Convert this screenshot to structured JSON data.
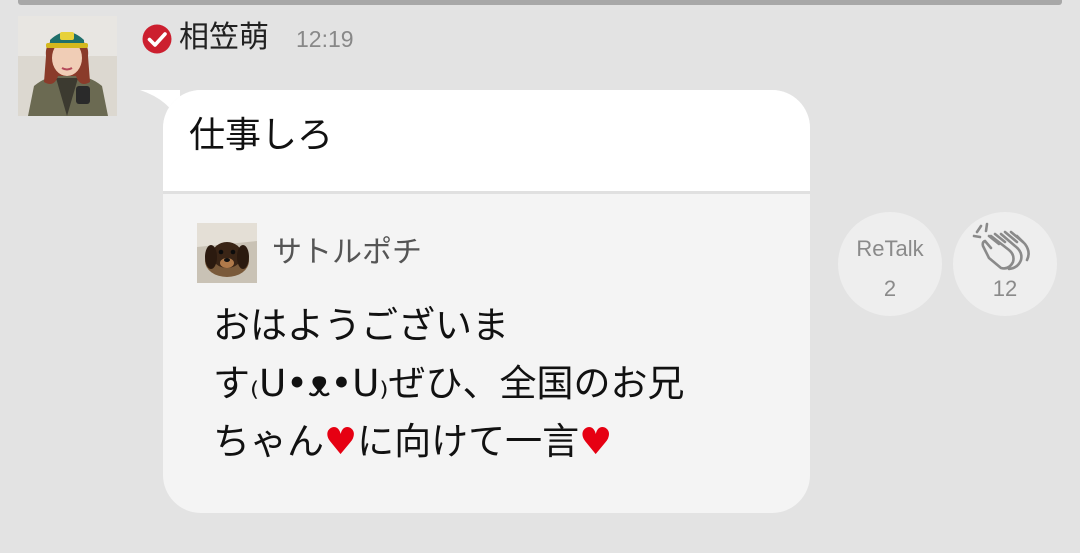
{
  "post": {
    "sender_name": "相笠萌",
    "time": "12:19",
    "message": "仕事しろ"
  },
  "quote": {
    "author": "サトルポチ",
    "lines": [
      "おはようございま",
      "す₍U•ᴥ•U₎ぜひ、全国のお兄",
      "ちゃん"
    ],
    "line3_middle": "に向けて一言",
    "heart": "♥"
  },
  "actions": {
    "retalk_label": "ReTalk",
    "retalk_count": "2",
    "clap_count": "12"
  },
  "icons": {
    "verified": "verified-check-icon",
    "clap": "clapping-hands-icon"
  },
  "colors": {
    "background": "#e3e3e3",
    "verified_red": "#cc1f2f",
    "heart_red": "#e60012",
    "bubble_white": "#ffffff",
    "quote_gray": "#f4f4f4"
  }
}
